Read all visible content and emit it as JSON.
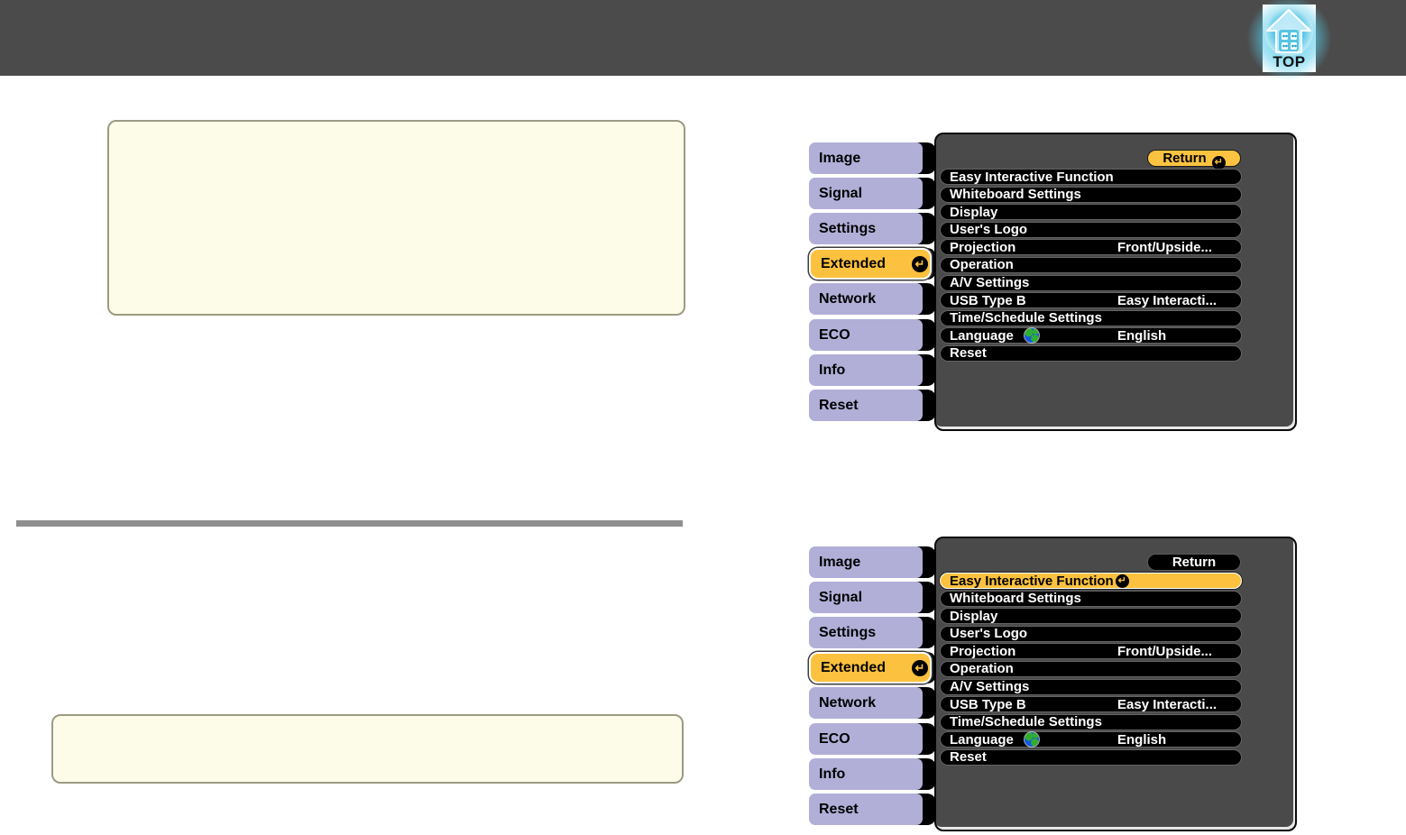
{
  "header": {
    "top_label": "TOP",
    "bg_color": "#4b4b4b",
    "top_icon": "home-arrow-icon",
    "glow_color": "#5acdeb"
  },
  "colors": {
    "tab_inactive": "#b1afd8",
    "highlight_orange": "#fcc13e",
    "panel_bg": "#4a4a4a",
    "row_bg": "#000000",
    "note_box_bg": "#fdfce9",
    "note_box_border": "#9b9b84",
    "divider": "#8f8f8f"
  },
  "osd": {
    "return_label": "Return",
    "enter_glyph": "↵",
    "tabs": [
      {
        "label": "Image",
        "active": false
      },
      {
        "label": "Signal",
        "active": false
      },
      {
        "label": "Settings",
        "active": false
      },
      {
        "label": "Extended",
        "active": true
      },
      {
        "label": "Network",
        "active": false
      },
      {
        "label": "ECO",
        "active": false
      },
      {
        "label": "Info",
        "active": false
      },
      {
        "label": "Reset",
        "active": false
      }
    ],
    "items": [
      {
        "label": "Easy Interactive Function",
        "value": ""
      },
      {
        "label": "Whiteboard Settings",
        "value": ""
      },
      {
        "label": "Display",
        "value": ""
      },
      {
        "label": "User's Logo",
        "value": ""
      },
      {
        "label": "Projection",
        "value": "Front/Upside..."
      },
      {
        "label": "Operation",
        "value": ""
      },
      {
        "label": "A/V Settings",
        "value": ""
      },
      {
        "label": "USB Type B",
        "value": "Easy Interacti..."
      },
      {
        "label": "Time/Schedule Settings",
        "value": ""
      },
      {
        "label": "Language",
        "value": "English",
        "icon": "globe-icon"
      },
      {
        "label": "Reset",
        "value": ""
      }
    ],
    "screens": [
      {
        "name": "extended-menu",
        "return_highlighted": true,
        "selected_item": null
      },
      {
        "name": "extended-menu-easy-interactive-selected",
        "return_highlighted": false,
        "selected_item": "Easy Interactive Function"
      }
    ]
  }
}
